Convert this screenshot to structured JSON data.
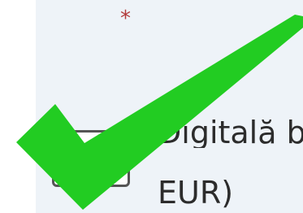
{
  "form": {
    "required_marker": "*",
    "option": {
      "label_line1": "Digitală b",
      "label_line2": "EUR)",
      "checked": true
    }
  },
  "overlay": {
    "icon": "checkmark-icon",
    "color": "#22cc22"
  }
}
